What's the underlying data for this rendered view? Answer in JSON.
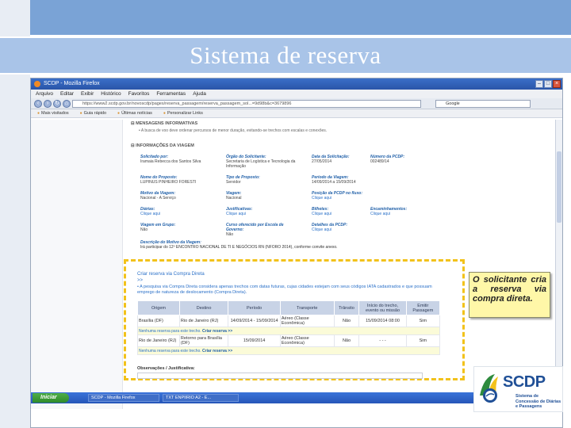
{
  "slide": {
    "title": "Sistema de reserva",
    "callout": "O solicitante cria a reserva via compra direta."
  },
  "browser": {
    "title": "SCDP - Mozilla Firefox",
    "menu": [
      "Arquivo",
      "Editar",
      "Exibir",
      "Histórico",
      "Favoritos",
      "Ferramentas",
      "Ajuda"
    ],
    "url": "https://www2.scdp.gov.br/novoscdp/pages/reserva_passagem/reserva_passagem_sol...=9d98b&c=3679896",
    "search": "Google",
    "bookmarks": [
      "Mais visitados",
      "Guia rápido",
      "Últimas notícias",
      "Personalizar Links"
    ]
  },
  "page": {
    "messages_header": "MENSAGENS INFORMATIVAS",
    "messages_text": "A busca de voo deve ordenar percursos de menor duração, evitando-se trechos com escalas e conexões.",
    "trip_header": "INFORMAÇÕES DA VIAGEM",
    "fields": [
      {
        "label": "Solicitado por:",
        "value": "Iramaia Rebecca dos Santos Silva"
      },
      {
        "label": "Órgão do Solicitante:",
        "value": "Secretaria de Logística e Tecnologia da Informação"
      },
      {
        "label": "Data da Solicitação:",
        "value": "27/05/2014"
      },
      {
        "label": "Número da PCDP:",
        "value": "002489/14"
      },
      {
        "label": "Nome do Proposto:",
        "value": "LUPINUS PINHEIRO FORESTI"
      },
      {
        "label": "Tipo de Proposto:",
        "value": "Servidor"
      },
      {
        "label": "Período da Viagem:",
        "value": "14/09/2014 a 15/09/2014"
      },
      {
        "label": "Motivo da Viagem:",
        "value": "Nacional - A Serviço"
      },
      {
        "label": "Viagem:",
        "value": "Nacional"
      },
      {
        "label": "Posição da PCDP no fluxo:",
        "link": "Clique aqui"
      },
      {
        "label": "Diárias:",
        "link": "Clique aqui"
      },
      {
        "label": "Justificativas:",
        "link": "Clique aqui"
      },
      {
        "label": "Bilhetes:",
        "link": "Clique aqui"
      },
      {
        "label": "Encaminhamentos:",
        "link": "Clique aqui"
      },
      {
        "label": "Viagem em Grupo:",
        "value": "Não"
      },
      {
        "label": "Curso oferecido por Escola de Governo:",
        "value": "Não"
      },
      {
        "label": "Detalhes da PCDP:",
        "link": "Clique aqui"
      }
    ],
    "description_label": "Descrição do Motivo da Viagem:",
    "description_text": "Irá participar do 12º ENCONTRO NACIONAL DE TI E NEGÓCIOS RN (NFORO 2014), conforme convite anexo."
  },
  "reserva": {
    "title": "Criar reserva via Compra Direta",
    "arrow": ">>",
    "note": "A pesquisa via Compra Direta considera apenas trechos com datas futuras, cujas cidades estejam com seus códigos IATA cadastrados e que possuam emprego de natureza de deslocamento (Compra Direta).",
    "columns": [
      "Origem",
      "Destino",
      "Período",
      "Transporte",
      "Trânsito",
      "Início do trecho, evento ou missão",
      "Emitir Passagem"
    ],
    "rows": [
      {
        "cells": [
          "Brasília (DF)",
          "Rio de Janeiro (RJ)",
          "14/09/2014 - 15/09/2014",
          "Aéreo (Classe Econômica)",
          "Não",
          "15/09/2014 08:00",
          "Sim"
        ],
        "notice": "Nenhuma reserva para este trecho.",
        "action": "Criar reserva >>"
      },
      {
        "cells": [
          "Rio de Janeiro (RJ)",
          "Retorno para Brasília (DF)",
          "15/09/2014",
          "Aéreo (Classe Econômica)",
          "Não",
          "- - -",
          "Sim"
        ],
        "notice": "Nenhuma reserva para este trecho.",
        "action": "Criar reserva >>"
      }
    ],
    "observations": "Observações / Justificativa:"
  },
  "taskbar": {
    "start": "Iniciar",
    "tasks": [
      "SCDP - Mozilla Firefox",
      "TXT ENPIIRIO A2 - E..."
    ]
  },
  "logo": {
    "name": "SCDP",
    "subtitle": "Sistema de Concessão de Diárias e Passagens"
  }
}
